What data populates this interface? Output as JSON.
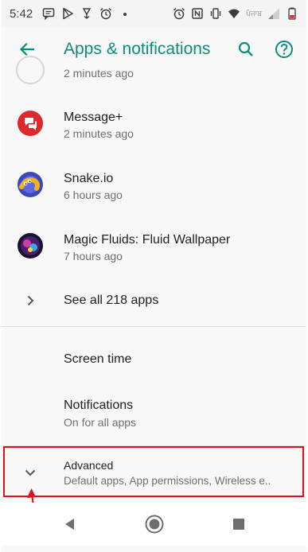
{
  "status_bar": {
    "time": "5:42",
    "carrier": "ਪੰਜਾਬ",
    "icons": [
      "message-icon",
      "play-store-icon",
      "download-icon",
      "alarm-icon",
      "dot-icon",
      "alarm-icon",
      "nfc-icon",
      "vibrate-icon",
      "wifi-icon",
      "signal-icon",
      "battery-icon"
    ]
  },
  "app_bar": {
    "title": "Apps & notifications",
    "back_icon": "arrow-back-icon",
    "search_icon": "search-icon",
    "help_icon": "help-icon"
  },
  "list": {
    "partial_sub": "2 minutes ago",
    "apps": [
      {
        "name": "Message+",
        "time": "2 minutes ago",
        "icon": "message-plus-app-icon"
      },
      {
        "name": "Snake.io",
        "time": "6 hours ago",
        "icon": "snake-io-app-icon"
      },
      {
        "name": "Magic Fluids: Fluid Wallpaper",
        "time": "7 hours ago",
        "icon": "magic-fluids-app-icon"
      }
    ],
    "see_all": "See all 218 apps",
    "screen_time": "Screen time",
    "notifications": {
      "title": "Notifications",
      "sub": "On for all apps"
    },
    "advanced": {
      "title": "Advanced",
      "sub": "Default apps, App permissions, Wireless e.."
    }
  },
  "colors": {
    "accent": "#0b8f7d",
    "highlight": "#e0101e",
    "message_red": "#e0272b"
  },
  "nav_bar": {
    "icons": [
      "back-triangle-icon",
      "home-circle-icon",
      "recents-square-icon"
    ]
  }
}
